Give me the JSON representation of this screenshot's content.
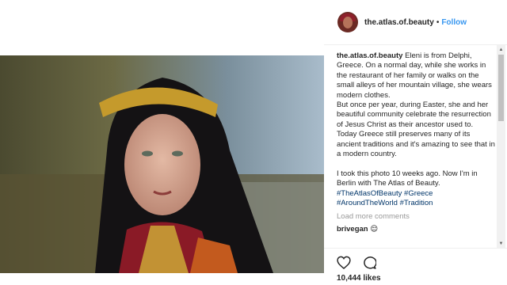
{
  "post": {
    "username": "the.atlas.of.beauty",
    "separator": "•",
    "follow_label": "Follow"
  },
  "caption": {
    "author": "the.atlas.of.beauty",
    "text": "Eleni is from Delphi, Greece. On a normal day, while she works in the restaurant of her family or walks on the small alleys of her mountain village, she wears modern clothes.\nBut once per year, during Easter, she and her beautiful community celebrate the resurrection of Jesus Christ as their ancestor used to.\nToday Greece still preserves many of its ancient traditions and it's amazing to see that in a modern country.\n\nI took this photo 10 weeks ago. Now I'm in Berlin with The Atlas of Beauty.",
    "hashtags": [
      "#TheAtlasOfBeauty",
      "#Greece",
      "#AroundTheWorld",
      "#Tradition"
    ]
  },
  "comments": {
    "load_more_label": "Load more comments",
    "reply_author": "brivegan",
    "reply_text": "😌"
  },
  "engagement": {
    "likes": "10,444 likes"
  },
  "icons": {
    "like": "heart-icon",
    "comment": "comment-icon",
    "scroll_up": "▲",
    "scroll_down": "▼"
  },
  "colors": {
    "link_blue": "#3897f0",
    "hashtag_blue": "#003569",
    "muted_text": "#999999",
    "text": "#262626"
  }
}
